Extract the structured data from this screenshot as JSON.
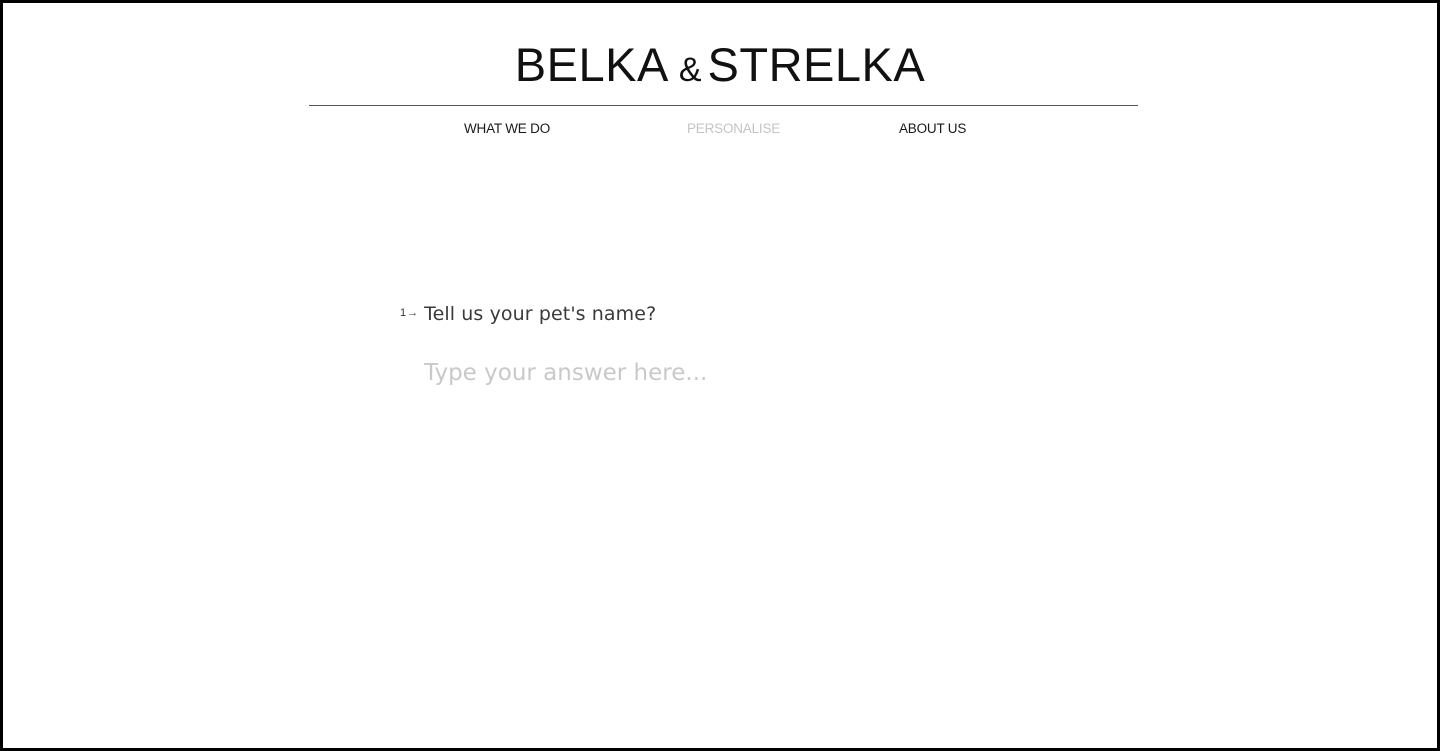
{
  "logo": {
    "word_left": "BELKA",
    "ampersand": "&",
    "word_right": "STRELKA"
  },
  "nav": {
    "items": [
      {
        "label": "WHAT WE DO",
        "active": false
      },
      {
        "label": "PERSONALISE",
        "active": true
      },
      {
        "label": "ABOUT US",
        "active": false
      }
    ]
  },
  "form": {
    "question_number": "1",
    "question_arrow": "→",
    "question_text": "Tell us your pet's name?",
    "answer_value": "",
    "answer_placeholder": "Type your answer here..."
  },
  "colors": {
    "border": "#000000",
    "text": "#1a1a1a",
    "active_nav": "#c4c4c4",
    "placeholder": "#c9c9c9"
  }
}
